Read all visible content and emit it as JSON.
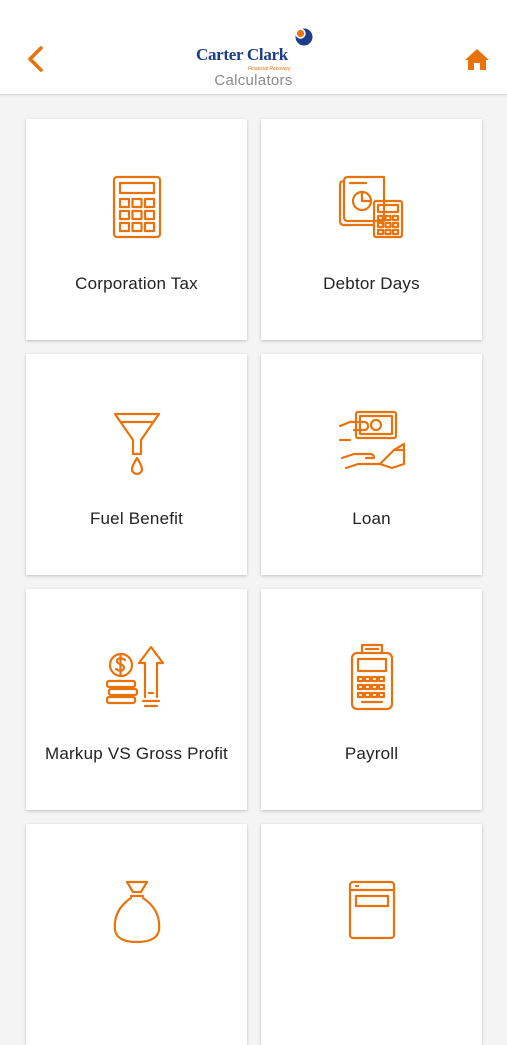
{
  "header": {
    "logo_name": "Carter Clark",
    "logo_tagline": "Financial Recovery",
    "subtitle": "Calculators"
  },
  "colors": {
    "accent": "#e8730c",
    "brand_blue": "#1b3d8a"
  },
  "calculators": [
    {
      "label": "Corporation Tax",
      "icon": "calculator-icon"
    },
    {
      "label": "Debtor Days",
      "icon": "invoice-calculator-icon"
    },
    {
      "label": "Fuel Benefit",
      "icon": "funnel-icon"
    },
    {
      "label": "Loan",
      "icon": "cash-hand-icon"
    },
    {
      "label": "Markup VS Gross Profit",
      "icon": "coins-growth-icon"
    },
    {
      "label": "Payroll",
      "icon": "payment-terminal-icon"
    },
    {
      "label": "",
      "icon": "money-bag-icon"
    },
    {
      "label": "",
      "icon": "web-window-icon"
    }
  ]
}
